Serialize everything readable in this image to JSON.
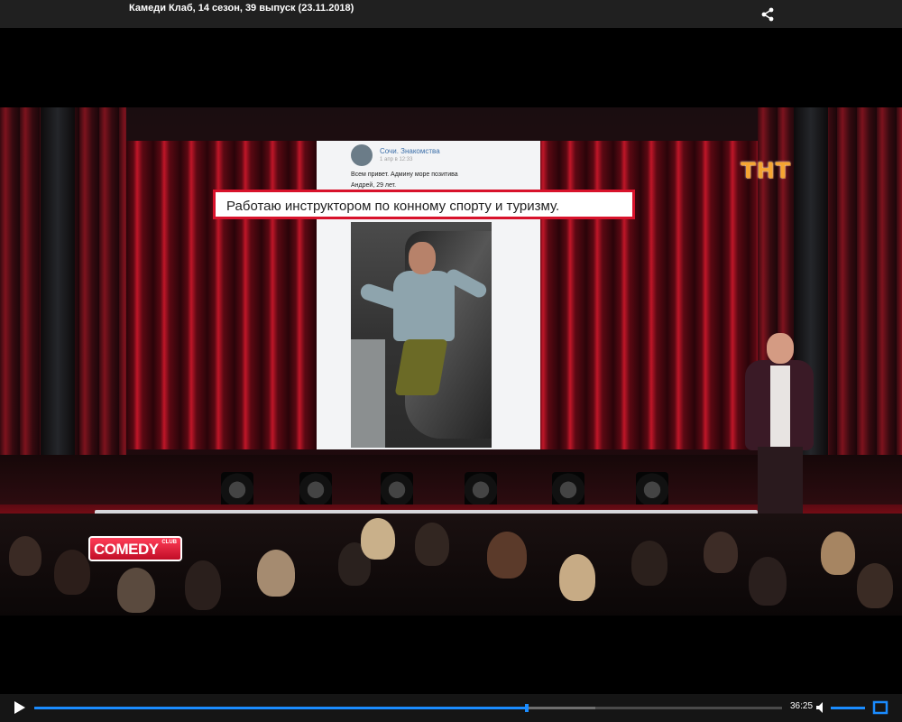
{
  "header": {
    "title": "Камеди Клаб, 14 сезон, 39 выпуск (23.11.2018)",
    "share_icon": "share-icon"
  },
  "video": {
    "screen": {
      "post_author": "Сочи. Знакомства",
      "post_time": "1 апр в 12:33",
      "post_line1": "Всем привет. Админу море позитива",
      "post_line2": "Андрей, 29 лет."
    },
    "caption": "Работаю инструктором по конному спорту и туризму.",
    "channel_logo": "ТНТ",
    "show_logo": {
      "main": "COMEDY",
      "sub": "CLUB"
    }
  },
  "player": {
    "play_icon": "play-icon",
    "progress_fraction": 0.659,
    "buffer_fraction": 0.75,
    "time": "36:25",
    "volume_icon": "volume-icon",
    "volume_fraction": 1.0,
    "fullscreen_icon": "fullscreen-icon",
    "accent_color": "#1a8cff"
  }
}
